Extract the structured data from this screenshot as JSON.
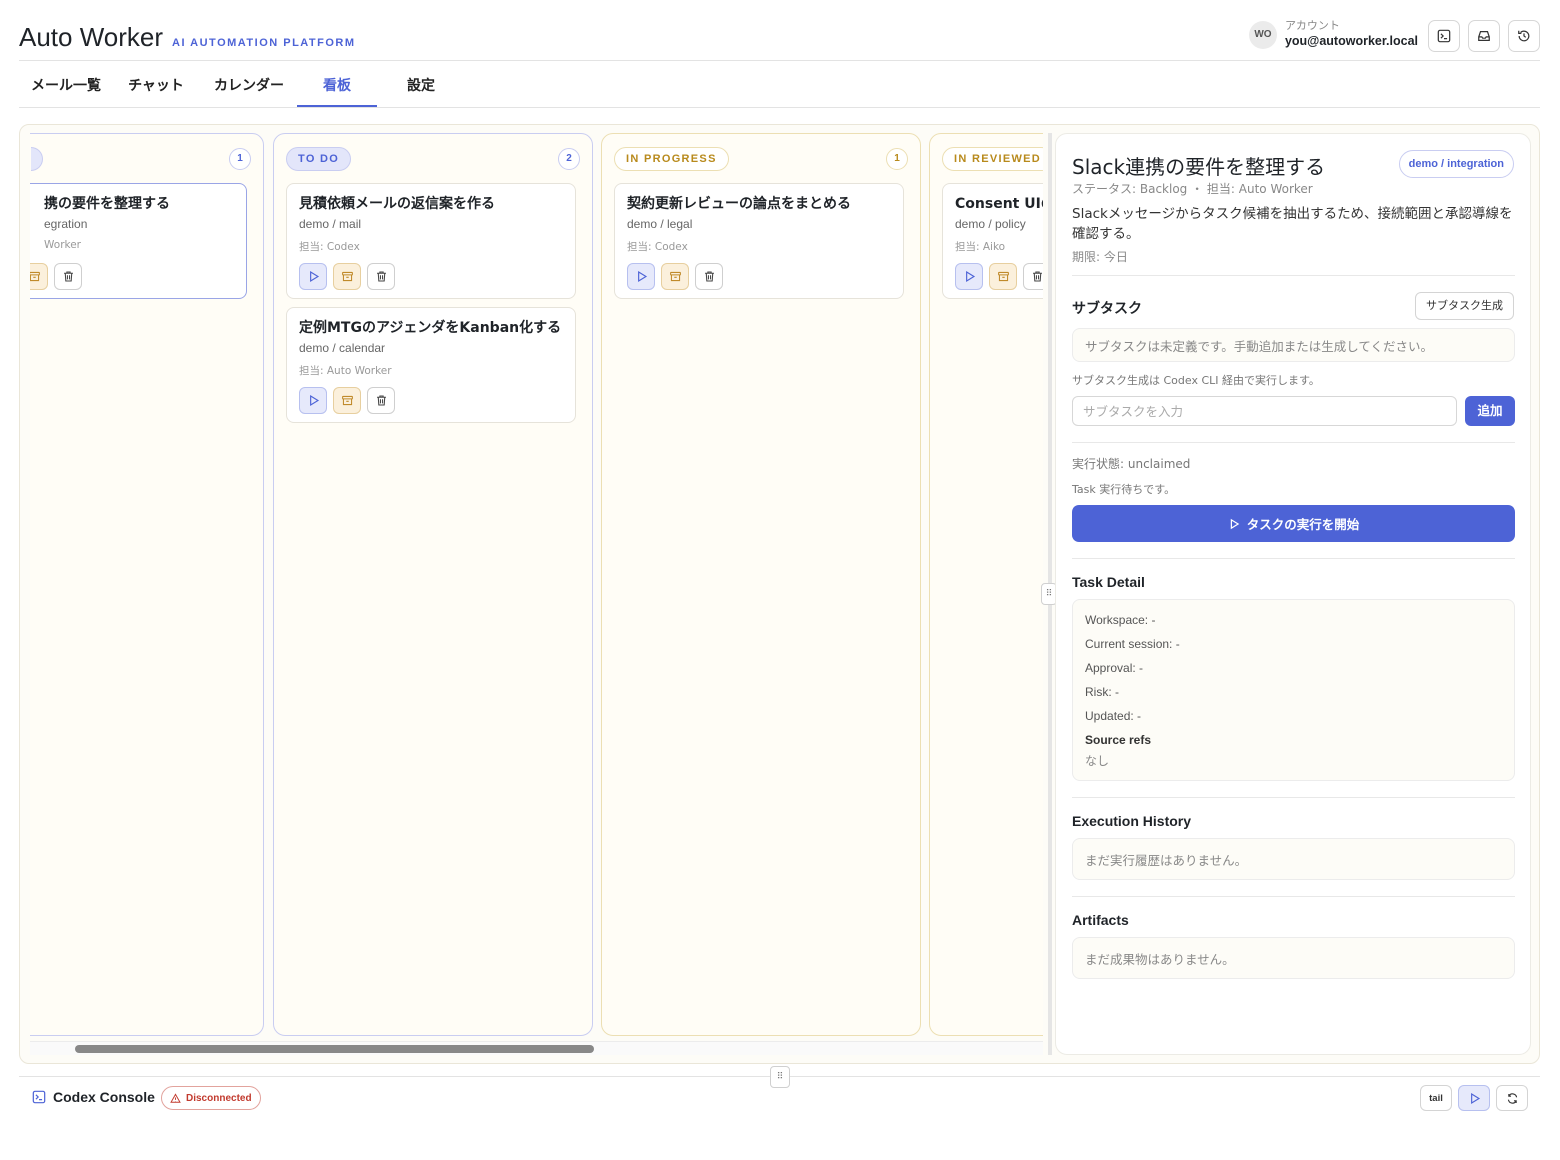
{
  "app": {
    "title": "Auto Worker",
    "subtitle": "AI AUTOMATION PLATFORM"
  },
  "account": {
    "avatar_initials": "WO",
    "label": "アカウント",
    "email": "you@autoworker.local",
    "buttons": [
      "terminal-icon",
      "inbox-icon",
      "history-icon"
    ]
  },
  "nav": {
    "tabs": [
      {
        "label": "メール一覧",
        "active": false
      },
      {
        "label": "チャット",
        "active": false
      },
      {
        "label": "カレンダー",
        "active": false
      },
      {
        "label": "看板",
        "active": true
      },
      {
        "label": "設定",
        "active": false
      }
    ]
  },
  "board": {
    "columns": [
      {
        "name": "",
        "count": "1",
        "cards": [
          {
            "title": "携の要件を整理する",
            "workspace": "egration",
            "assignee": "Worker"
          }
        ]
      },
      {
        "name": "TO DO",
        "count": "2",
        "cards": [
          {
            "title": "見積依頼メールの返信案を作る",
            "workspace": "demo / mail",
            "assignee": "担当: Codex"
          },
          {
            "title": "定例MTGのアジェンダをKanban化する",
            "workspace": "demo / calendar",
            "assignee": "担当: Auto Worker"
          }
        ]
      },
      {
        "name": "IN PROGRESS",
        "count": "1",
        "cards": [
          {
            "title": "契約更新レビューの論点をまとめる",
            "workspace": "demo / legal",
            "assignee": "担当: Codex"
          }
        ]
      },
      {
        "name": "IN REVIEWED",
        "count": "",
        "cards": [
          {
            "title": "Consent UIの",
            "workspace": "demo / policy",
            "assignee": "担当: Aiko"
          }
        ]
      }
    ]
  },
  "detail": {
    "title": "Slack連携の要件を整理する",
    "tag": "demo / integration",
    "meta": "ステータス: Backlog ・ 担当: Auto Worker",
    "description": "Slackメッセージからタスク候補を抽出するため、接続範囲と承認導線を確認する。",
    "due": "期限: 今日",
    "subtasks": {
      "title": "サブタスク",
      "generate_label": "サブタスク生成",
      "empty": "サブタスクは未定義です。手動追加または生成してください。",
      "note": "サブタスク生成は Codex CLI 経由で実行します。",
      "input_placeholder": "サブタスクを入力",
      "add_label": "追加"
    },
    "execution": {
      "state": "実行状態: unclaimed",
      "waiting": "Task 実行待ちです。",
      "start_label": "タスクの実行を開始"
    },
    "task_detail": {
      "title": "Task Detail",
      "workspace": "Workspace: -",
      "current_session": "Current session: -",
      "approval": "Approval: -",
      "risk": "Risk: -",
      "updated": "Updated: -",
      "source_refs_label": "Source refs",
      "source_refs_value": "なし"
    },
    "history": {
      "title": "Execution History",
      "empty": "まだ実行履歴はありません。"
    },
    "artifacts": {
      "title": "Artifacts",
      "empty": "まだ成果物はありません。"
    }
  },
  "console": {
    "title": "Codex Console",
    "status": "Disconnected",
    "tail_label": "tail"
  },
  "colors": {
    "accent": "#4d63d6",
    "warning_text": "#b88a1c",
    "error": "#c23a2e"
  }
}
